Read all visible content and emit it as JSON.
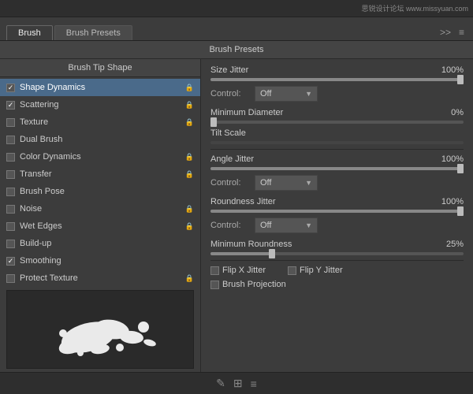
{
  "topbar": {
    "watermark": "思锐设计论坛  www.missyuan.com"
  },
  "tabs": [
    {
      "label": "Brush",
      "active": true
    },
    {
      "label": "Brush Presets",
      "active": false
    }
  ],
  "tab_icons": [
    ">>",
    "≡"
  ],
  "brush_presets_header": "Brush Presets",
  "left_panel": {
    "header": "Brush Tip Shape",
    "items": [
      {
        "label": "Shape Dynamics",
        "checked": true,
        "lock": true,
        "active": true
      },
      {
        "label": "Scattering",
        "checked": true,
        "lock": true,
        "active": false
      },
      {
        "label": "Texture",
        "checked": false,
        "lock": true,
        "active": false
      },
      {
        "label": "Dual Brush",
        "checked": false,
        "lock": false,
        "active": false
      },
      {
        "label": "Color Dynamics",
        "checked": false,
        "lock": true,
        "active": false
      },
      {
        "label": "Transfer",
        "checked": false,
        "lock": true,
        "active": false
      },
      {
        "label": "Brush Pose",
        "checked": false,
        "lock": false,
        "active": false
      },
      {
        "label": "Noise",
        "checked": false,
        "lock": true,
        "active": false
      },
      {
        "label": "Wet Edges",
        "checked": false,
        "lock": true,
        "active": false
      },
      {
        "label": "Build-up",
        "checked": false,
        "lock": false,
        "active": false
      },
      {
        "label": "Smoothing",
        "checked": true,
        "lock": false,
        "active": false
      },
      {
        "label": "Protect Texture",
        "checked": false,
        "lock": true,
        "active": false
      }
    ]
  },
  "right_panel": {
    "size_jitter": {
      "label": "Size Jitter",
      "value": "100%",
      "fill_pct": 100
    },
    "size_jitter_control": {
      "label": "Control:",
      "value": "Off"
    },
    "minimum_diameter": {
      "label": "Minimum Diameter",
      "value": "0%",
      "fill_pct": 0
    },
    "tilt_scale": {
      "label": "Tilt Scale",
      "value": ""
    },
    "angle_jitter": {
      "label": "Angle Jitter",
      "value": "100%",
      "fill_pct": 100
    },
    "angle_jitter_control": {
      "label": "Control:",
      "value": "Off"
    },
    "roundness_jitter": {
      "label": "Roundness Jitter",
      "value": "100%",
      "fill_pct": 100
    },
    "roundness_jitter_control": {
      "label": "Control:",
      "value": "Off"
    },
    "minimum_roundness": {
      "label": "Minimum Roundness",
      "value": "25%",
      "fill_pct": 25
    },
    "flip_x": {
      "label": "Flip X Jitter"
    },
    "flip_y": {
      "label": "Flip Y Jitter"
    },
    "brush_projection": {
      "label": "Brush Projection"
    }
  },
  "bottom_icons": [
    "✎",
    "⊞",
    "⬛"
  ]
}
